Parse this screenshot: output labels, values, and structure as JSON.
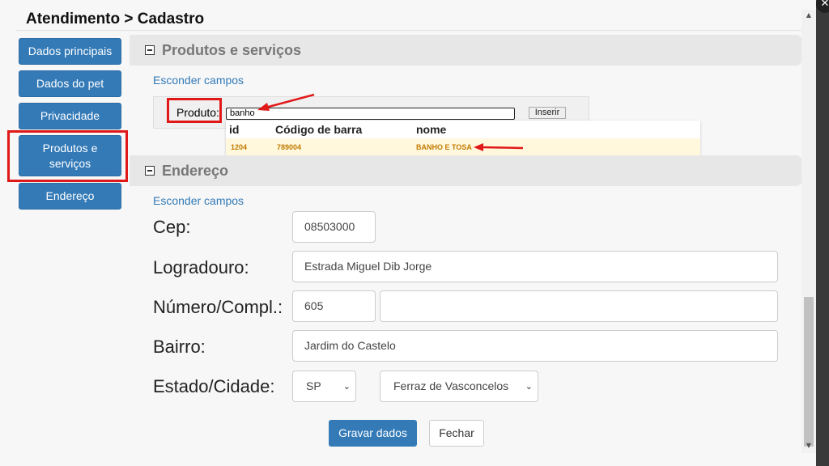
{
  "header": {
    "title": "Atendimento > Cadastro",
    "close_icon": "close-icon"
  },
  "sidebar": {
    "items": [
      {
        "label": "Dados principais"
      },
      {
        "label": "Dados do pet"
      },
      {
        "label": "Privacidade"
      },
      {
        "label": "Produtos e serviços"
      },
      {
        "label": "Endereço"
      }
    ],
    "highlighted_item": "Produtos e serviços"
  },
  "produtos": {
    "section_title": "Produtos e serviços",
    "toggle_link": "Esconder campos",
    "produto_label": "Produto:",
    "produto_value": "banho",
    "insert_label": "Inserir",
    "autocomplete": {
      "headers": [
        "id",
        "Código de barra",
        "nome"
      ],
      "rows": [
        {
          "id": "1204",
          "barcode": "789004",
          "nome": "BANHO E TOSA"
        }
      ]
    }
  },
  "endereco": {
    "section_title": "Endereço",
    "toggle_link": "Esconder campos",
    "cep_label": "Cep:",
    "cep_value": "08503000",
    "logradouro_label": "Logradouro:",
    "logradouro_value": "Estrada Miguel Dib Jorge",
    "numero_label": "Número/Compl.:",
    "numero_value": "605",
    "complemento_value": "",
    "bairro_label": "Bairro:",
    "bairro_value": "Jardim do Castelo",
    "estado_cidade_label": "Estado/Cidade:",
    "estado_value": "SP",
    "cidade_value": "Ferraz de Vasconcelos"
  },
  "actions": {
    "save_label": "Gravar dados",
    "close_label": "Fechar"
  },
  "colors": {
    "primary": "#337ab7",
    "annotation": "#e01818",
    "autocomplete_highlight": "#fff8dd",
    "autocomplete_text": "#c27a00"
  }
}
